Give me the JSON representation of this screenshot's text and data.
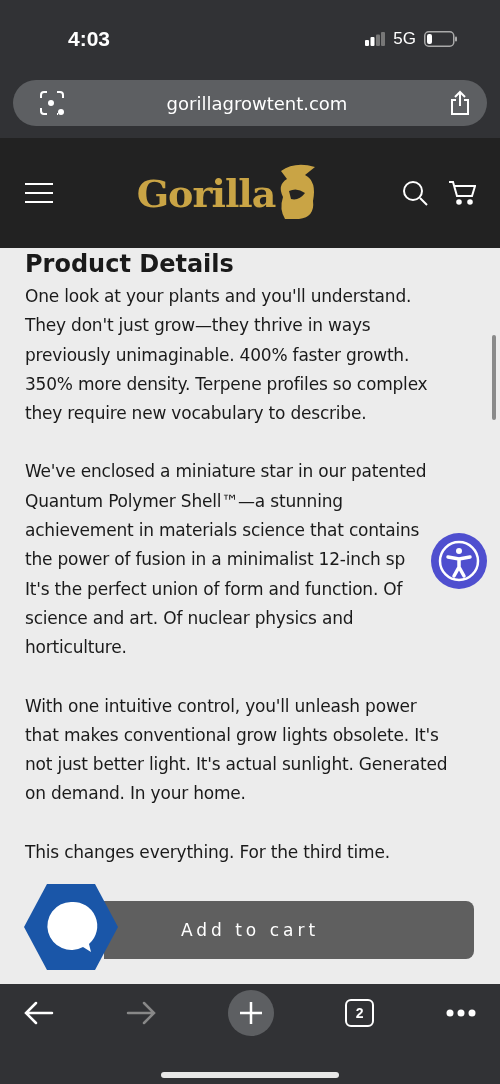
{
  "status_bar": {
    "time": "4:03",
    "network": "5G"
  },
  "address_bar": {
    "url": "gorillagrowtent.com"
  },
  "site_header": {
    "logo": "Gorilla"
  },
  "product_details": {
    "heading": "Product Details",
    "paragraphs": [
      [
        "One look at your plants and you'll understand.",
        "They don't just grow—they thrive in ways",
        "previously unimaginable. 400% faster growth.",
        "350% more density. Terpene profiles so complex",
        "they require new vocabulary to describe."
      ],
      [
        "We've enclosed a miniature star in our patented",
        "Quantum Polymer Shell™—a stunning",
        "achievement in materials science that contains",
        "the power of fusion in a minimalist 12-inch sp",
        "It's the perfect union of form and function. Of",
        "science and art. Of nuclear physics and",
        "horticulture."
      ],
      [
        "With one intuitive control, you'll unleash power",
        "that makes conventional grow lights obsolete. It's",
        "not just better light. It's actual sunlight. Generated",
        "on demand. In your home."
      ],
      [
        "This changes everything. For the third time."
      ]
    ]
  },
  "add_to_cart": {
    "label": "Add to cart"
  },
  "browser_toolbar": {
    "tab_count": "2"
  }
}
